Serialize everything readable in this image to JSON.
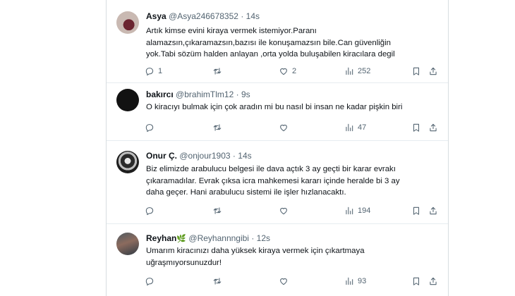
{
  "tweets": [
    {
      "name": "Asya",
      "handle": "@Asya246678352",
      "dot": "·",
      "time": "14s",
      "lines": [
        "Artık kimse evini kiraya vermek istemiyor.Paranı",
        "alamazsın,çıkaramazsın,bazısı ile konuşamazsın bile.Can güvenliğin",
        "yok.Tabi sözüm halden anlayan ,orta yolda buluşabilen kiracılara degil"
      ],
      "stats": {
        "replies": "1",
        "likes": "2",
        "views": "252"
      }
    },
    {
      "name": "bakırcı",
      "handle": "@brahimTlm12",
      "dot": "·",
      "time": "9s",
      "lines": [
        "O kiracıyı bulmak için çok aradın mi bu nasıl bi insan ne kadar pişkin biri"
      ],
      "stats": {
        "views": "47"
      }
    },
    {
      "name": "Onur Ç.",
      "handle": "@onjour1903",
      "dot": "·",
      "time": "14s",
      "lines": [
        "Biz elimizde arabulucu belgesi ile dava açtık 3 ay geçti bir karar evrakı",
        "çıkaramadılar. Evrak çıksa icra mahkemesi kararı içinde heralde bi 3 ay",
        "daha geçer. Hani arabulucu sistemi ile işler hızlanacaktı."
      ],
      "stats": {
        "views": "194"
      }
    },
    {
      "name": "Reyhan",
      "name_emoji": "🌿",
      "handle": "@Reyhannngibi",
      "dot": "·",
      "time": "12s",
      "lines": [
        "Umarım kiracınızı daha yüksek kiraya vermek için çıkartmaya",
        "uğraşmıyorsunuzdur!"
      ],
      "stats": {
        "views": "93"
      }
    }
  ],
  "icons": {
    "reply": "reply-icon",
    "retweet": "retweet-icon",
    "like": "heart-icon",
    "views": "views-icon",
    "bookmark": "bookmark-icon",
    "share": "share-icon"
  },
  "colors": {
    "text": "#0f1419",
    "secondary": "#536471",
    "divider": "#e6ecf0"
  }
}
